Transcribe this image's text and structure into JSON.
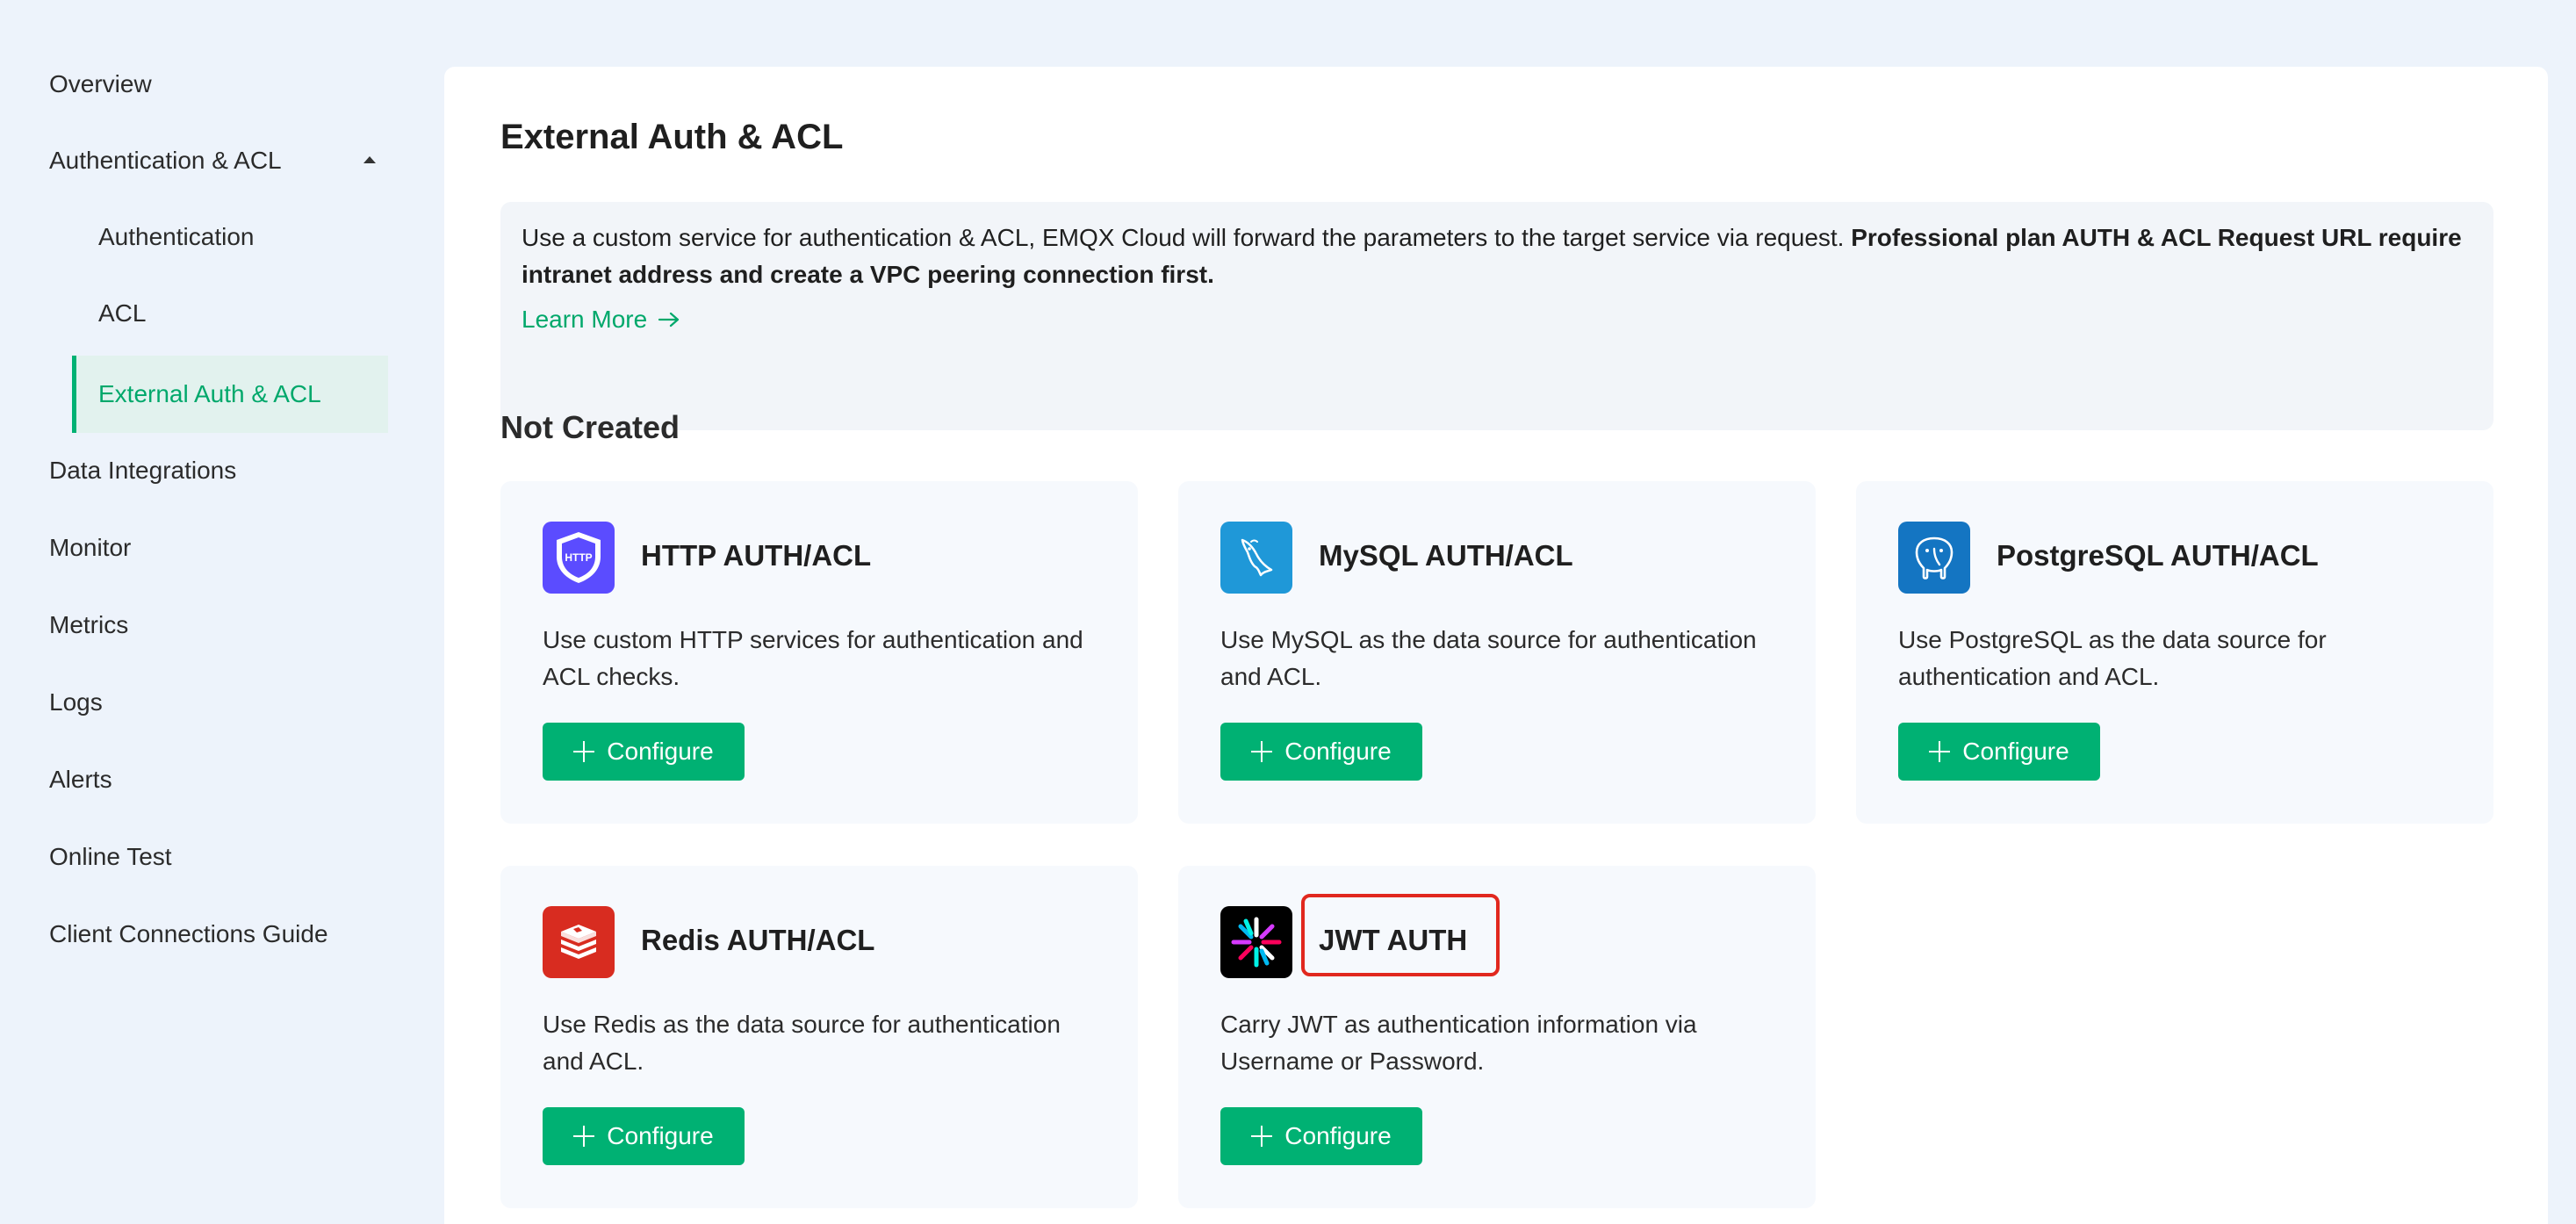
{
  "sidebar": {
    "items": [
      {
        "label": "Overview"
      },
      {
        "label": "Authentication & ACL"
      },
      {
        "label": "Authentication"
      },
      {
        "label": "ACL"
      },
      {
        "label": "External Auth & ACL"
      },
      {
        "label": "Data Integrations"
      },
      {
        "label": "Monitor"
      },
      {
        "label": "Metrics"
      },
      {
        "label": "Logs"
      },
      {
        "label": "Alerts"
      },
      {
        "label": "Online Test"
      },
      {
        "label": "Client Connections Guide"
      }
    ]
  },
  "main": {
    "title": "External Auth & ACL",
    "info": {
      "text": "Use a custom service for authentication & ACL, EMQX Cloud will forward the parameters to the target service via request. ",
      "bold": "Professional plan AUTH & ACL Request URL require intranet address and create a VPC peering connection first.",
      "learn_more": "Learn More"
    },
    "section_title": "Not Created",
    "cards": [
      {
        "title": "HTTP AUTH/ACL",
        "desc": "Use custom HTTP services for authentication and ACL checks.",
        "button": "Configure",
        "icon": "http-shield-icon",
        "icon_text": "HTTP"
      },
      {
        "title": "MySQL AUTH/ACL",
        "desc": "Use MySQL as the data source for authentication and ACL.",
        "button": "Configure",
        "icon": "mysql-dolphin-icon"
      },
      {
        "title": "PostgreSQL AUTH/ACL",
        "desc": "Use PostgreSQL as the data source for authentication and ACL.",
        "button": "Configure",
        "icon": "postgresql-elephant-icon"
      },
      {
        "title": "Redis AUTH/ACL",
        "desc": "Use Redis as the data source for authentication and ACL.",
        "button": "Configure",
        "icon": "redis-stack-icon"
      },
      {
        "title": "JWT AUTH",
        "desc": "Carry JWT as authentication information via Username or Password.",
        "button": "Configure",
        "icon": "jwt-burst-icon"
      }
    ]
  },
  "colors": {
    "accent": "#00b173",
    "highlight": "#e1281e",
    "http_icon": "#5b4cff",
    "mysql_icon": "#1f98d8",
    "postgresql_icon": "#1475c2",
    "redis_icon": "#d82c20",
    "jwt_icon": "#000000"
  }
}
